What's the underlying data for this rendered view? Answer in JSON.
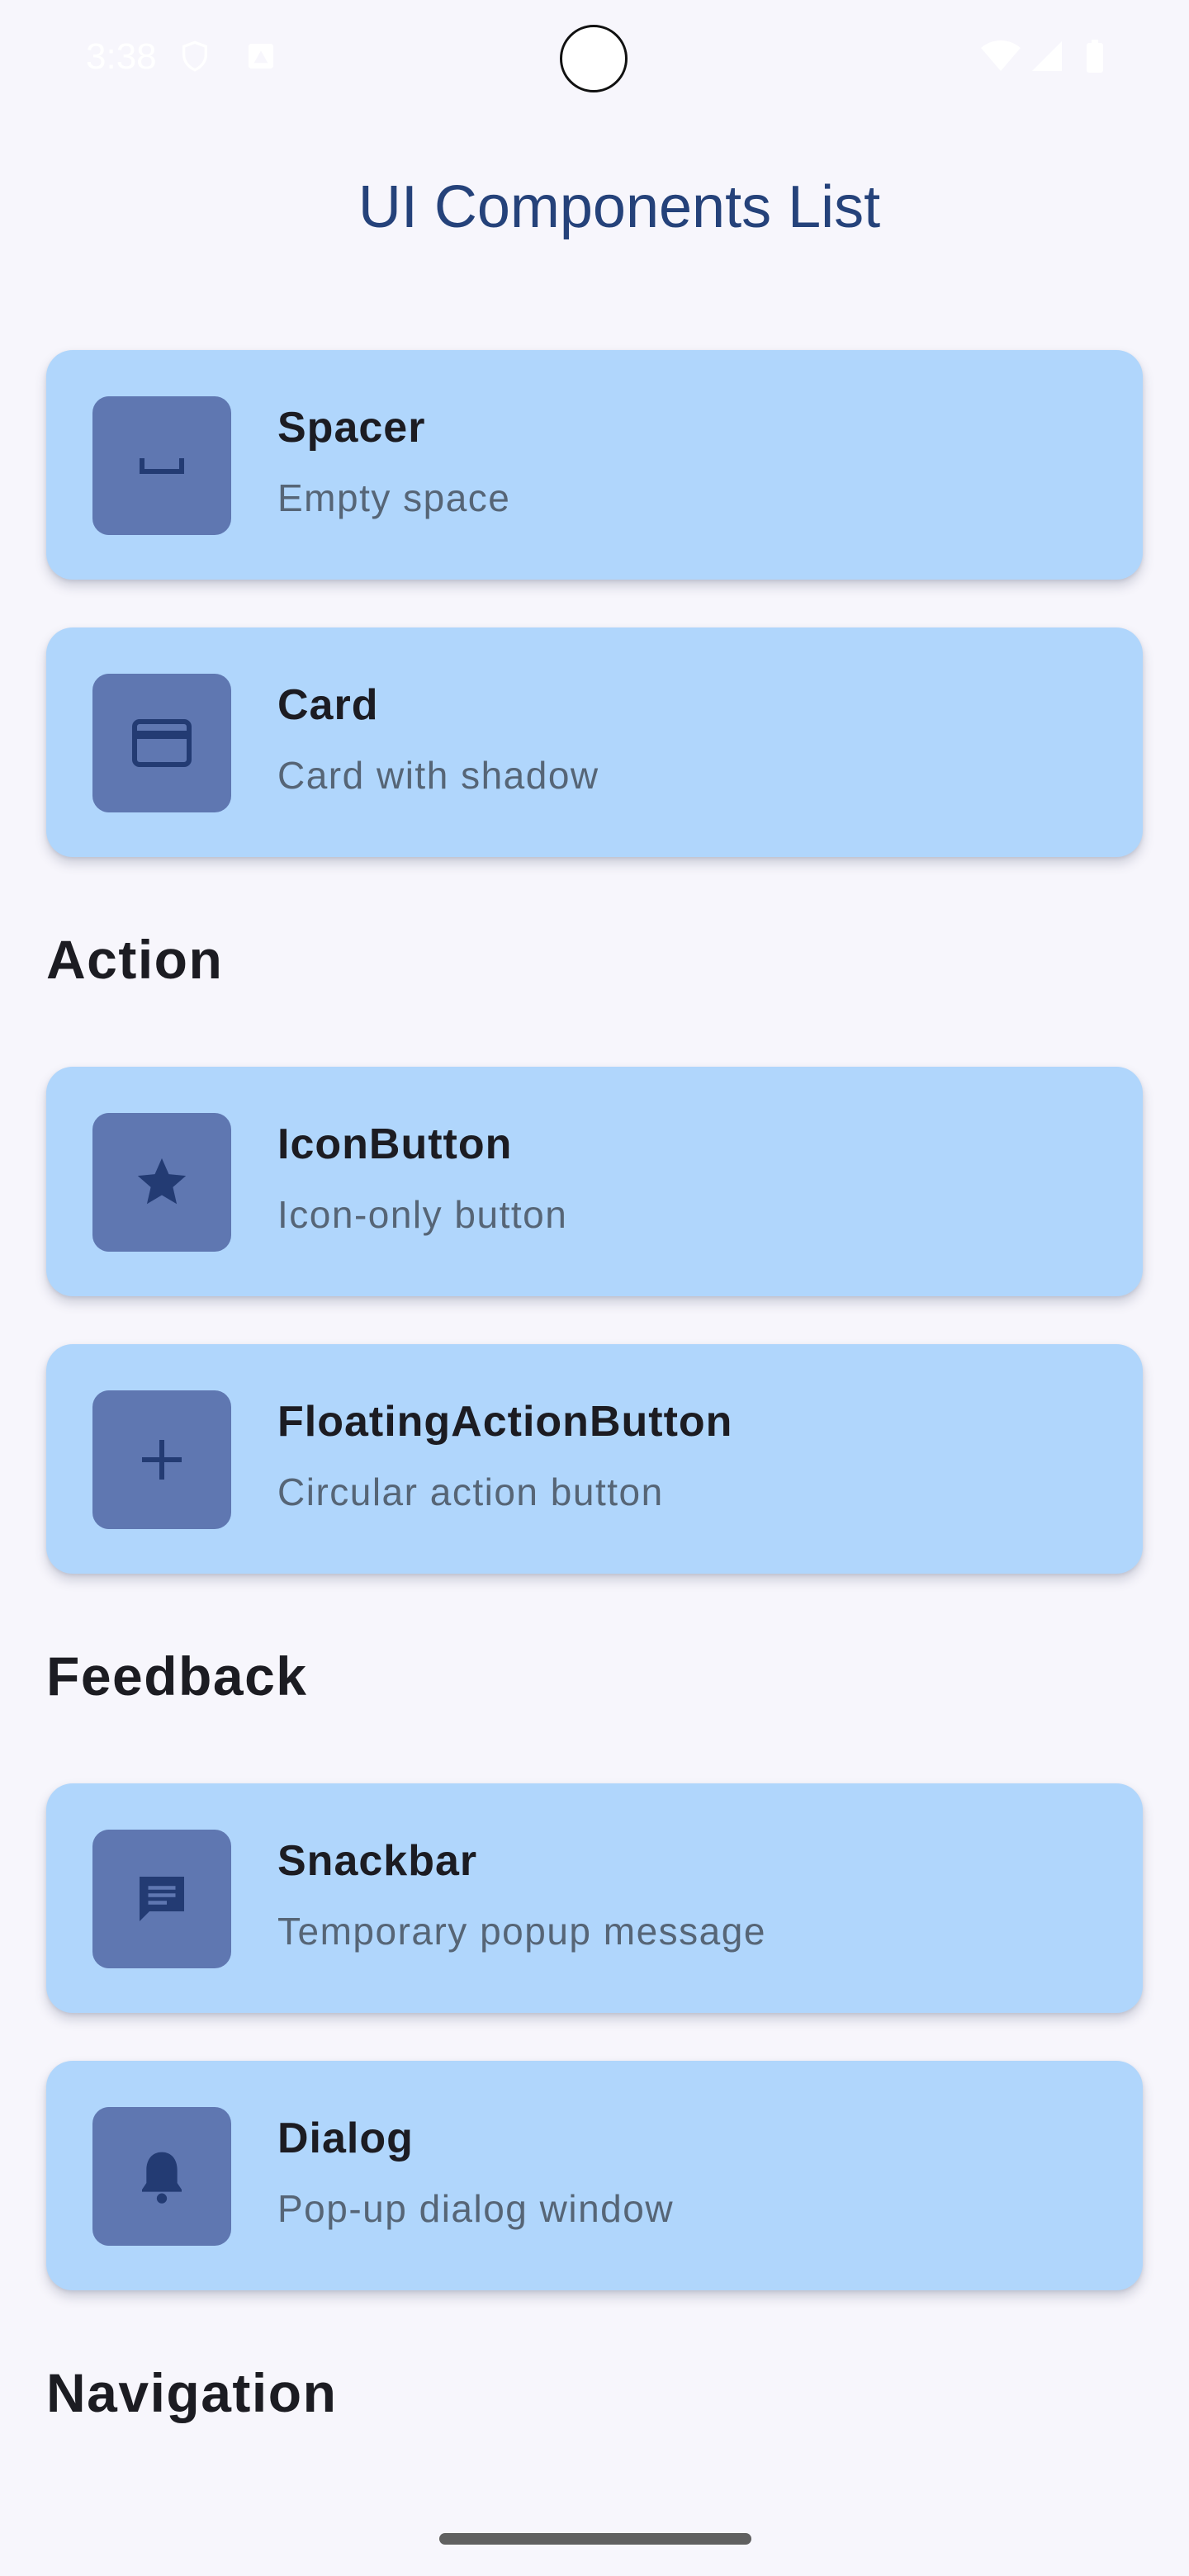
{
  "status_bar": {
    "time": "3:38",
    "icons": [
      "shield-icon",
      "notification-icon",
      "wifi-icon",
      "cellular-signal-icon",
      "battery-icon"
    ]
  },
  "header": {
    "title": "UI Components List"
  },
  "items": [
    {
      "title": "Spacer",
      "subtitle": "Empty space",
      "icon": "spacer-icon"
    },
    {
      "title": "Card",
      "subtitle": "Card with shadow",
      "icon": "credit-card-icon"
    },
    {
      "title": "IconButton",
      "subtitle": "Icon-only button",
      "icon": "star-icon"
    },
    {
      "title": "FloatingActionButton",
      "subtitle": "Circular action button",
      "icon": "plus-icon"
    },
    {
      "title": "Snackbar",
      "subtitle": "Temporary popup message",
      "icon": "message-icon"
    },
    {
      "title": "Dialog",
      "subtitle": "Pop-up dialog window",
      "icon": "bell-icon"
    }
  ],
  "sections": [
    {
      "label": "Action"
    },
    {
      "label": "Feedback"
    },
    {
      "label": "Navigation"
    }
  ],
  "colors": {
    "background": "#f7f6fc",
    "card": "#b0d6fc",
    "icon_box": "#5f77b1",
    "icon_glyph": "#233b73",
    "title": "#25427a",
    "text_primary": "#1c1c22",
    "text_secondary": "#566576"
  }
}
